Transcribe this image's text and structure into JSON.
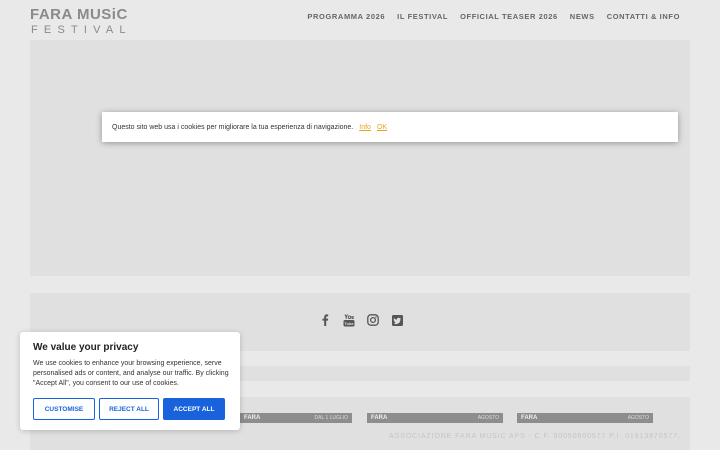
{
  "header": {
    "logo_top": "FARA MUSiC",
    "logo_bottom": "FESTIVAL",
    "nav": [
      {
        "label": "PROGRAMMA 2026"
      },
      {
        "label": "IL FESTIVAL"
      },
      {
        "label": "OFFICIAL TEASER 2026"
      },
      {
        "label": "NEWS"
      },
      {
        "label": "CONTATTI & INFO"
      }
    ]
  },
  "cookie_bar": {
    "text": "Questo sito web usa i cookies per migliorare la tua esperienza di navigazione.",
    "info_label": "Info",
    "ok_label": "OK",
    "link_color": "#e4a51b"
  },
  "social": {
    "icons": [
      "facebook-icon",
      "youtube-icon",
      "instagram-icon",
      "twitter-icon"
    ]
  },
  "partners": [
    {
      "name": "FARA",
      "sub": "DAL 1 LUGLIO"
    },
    {
      "name": "FARA",
      "sub": "AGOSTO"
    },
    {
      "name": "FARA",
      "sub": "AGOSTO"
    }
  ],
  "footer": {
    "text": "ASSOCIAZIONE FARA MUSIC APS - C.F. 90050600577 P.I. 01913870577,"
  },
  "privacy": {
    "title": "We value your privacy",
    "body": "We use cookies to enhance your browsing experience, serve personalised ads or content, and analyse our traffic. By clicking \"Accept All\", you consent to our use of cookies.",
    "customise_label": "CUSTOMISE",
    "reject_label": "REJECT ALL",
    "accept_label": "ACCEPT ALL",
    "accent_color": "#1863dc"
  }
}
